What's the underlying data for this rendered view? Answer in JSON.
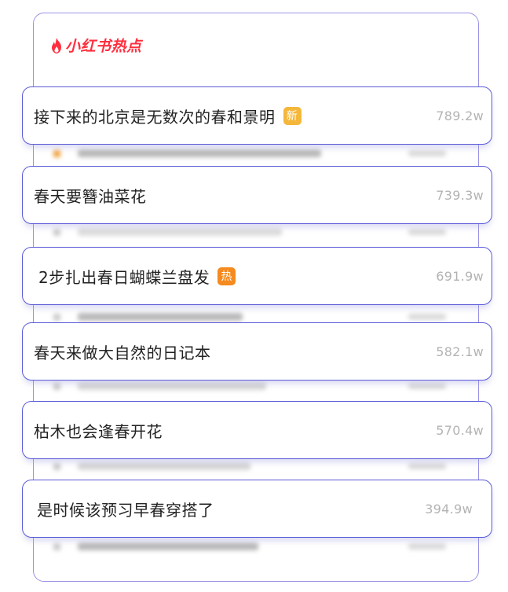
{
  "header": {
    "logo_text": "小红书热点"
  },
  "items": [
    {
      "title": "接下来的北京是无数次的春和景明",
      "score": "789.2w",
      "badge": "新",
      "badge_type": "new"
    },
    {
      "title": "春天要簪油菜花",
      "score": "739.3w",
      "badge": "",
      "badge_type": ""
    },
    {
      "title": "2步扎出春日蝴蝶兰盘发",
      "score": "691.9w",
      "badge": "热",
      "badge_type": "hot"
    },
    {
      "title": "春天来做大自然的日记本",
      "score": "582.1w",
      "badge": "",
      "badge_type": ""
    },
    {
      "title": "枯木也会逢春开花",
      "score": "570.4w",
      "badge": "",
      "badge_type": ""
    },
    {
      "title": "是时候该预习早春穿搭了",
      "score": "394.9w",
      "badge": "",
      "badge_type": ""
    }
  ],
  "colors": {
    "brand": "#ff2f3f",
    "card_border": "#5a5ad8",
    "badge_new": "#f4b73b",
    "badge_hot": "#f58a1e"
  },
  "icons": {
    "logo": "flame-icon"
  }
}
